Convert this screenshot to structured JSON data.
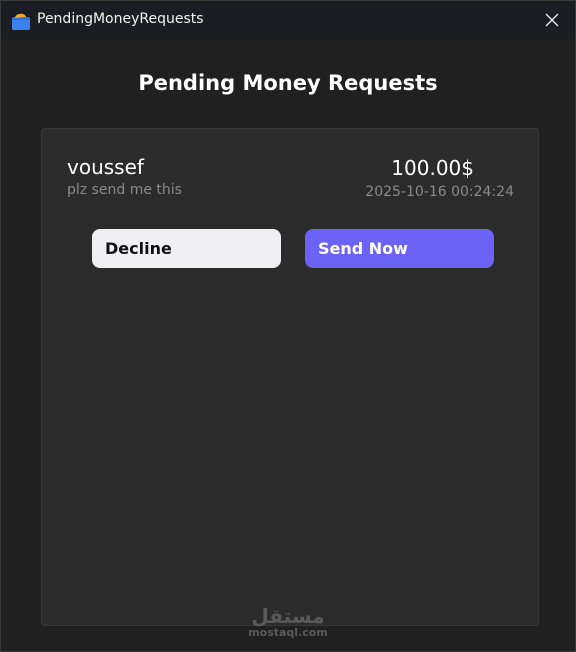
{
  "window": {
    "title": "PendingMoneyRequests",
    "icon": "wallet-icon",
    "close_icon": "close-icon"
  },
  "page": {
    "heading": "Pending Money Requests"
  },
  "requests": [
    {
      "name": "voussef",
      "note": "plz send me this",
      "amount": "100.00$",
      "datetime": "2025-10-16 00:24:24",
      "decline_label": "Decline",
      "send_label": "Send Now"
    }
  ],
  "watermark": {
    "arabic": "مستقل",
    "latin": "mostaql.com"
  },
  "colors": {
    "accent": "#6a63f6",
    "background": "#202020",
    "card": "#2b2b2b",
    "decline_bg": "#f0eff4"
  }
}
